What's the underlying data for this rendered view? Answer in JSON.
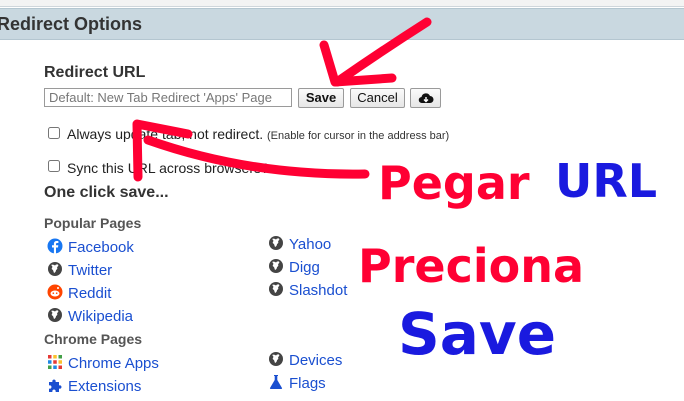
{
  "header": {
    "title": "Redirect Options"
  },
  "redirect": {
    "label": "Redirect URL",
    "placeholder": "Default: New Tab Redirect 'Apps' Page",
    "save_label": "Save",
    "cancel_label": "Cancel",
    "cloud_icon": "cloud-download-icon"
  },
  "options": [
    {
      "label": "Always update tab, not redirect.",
      "note": "(Enable for cursor in the address bar)",
      "checked": false
    },
    {
      "label": "Sync this URL across browsers?",
      "checked": false
    }
  ],
  "one_click": {
    "title": "One click save...",
    "popular_title": "Popular Pages",
    "popular_left": [
      {
        "label": "Facebook",
        "icon": "facebook-icon"
      },
      {
        "label": "Twitter",
        "icon": "globe-icon"
      },
      {
        "label": "Reddit",
        "icon": "reddit-icon"
      },
      {
        "label": "Wikipedia",
        "icon": "globe-icon"
      }
    ],
    "popular_right": [
      {
        "label": "Yahoo",
        "icon": "globe-icon"
      },
      {
        "label": "Digg",
        "icon": "globe-icon"
      },
      {
        "label": "Slashdot",
        "icon": "globe-icon"
      }
    ],
    "chrome_title": "Chrome Pages",
    "chrome_left": [
      {
        "label": "Chrome Apps",
        "icon": "apps-grid-icon"
      },
      {
        "label": "Extensions",
        "icon": "puzzle-icon"
      }
    ],
    "chrome_right": [
      {
        "label": "Devices",
        "icon": "globe-icon"
      },
      {
        "label": "Flags",
        "icon": "flask-icon"
      }
    ]
  },
  "annotations": {
    "pegar": "Pegar",
    "url": "URL",
    "preciona": "Preciona",
    "save": "Save",
    "red": "#ff0033",
    "blue": "#1a1adf"
  }
}
